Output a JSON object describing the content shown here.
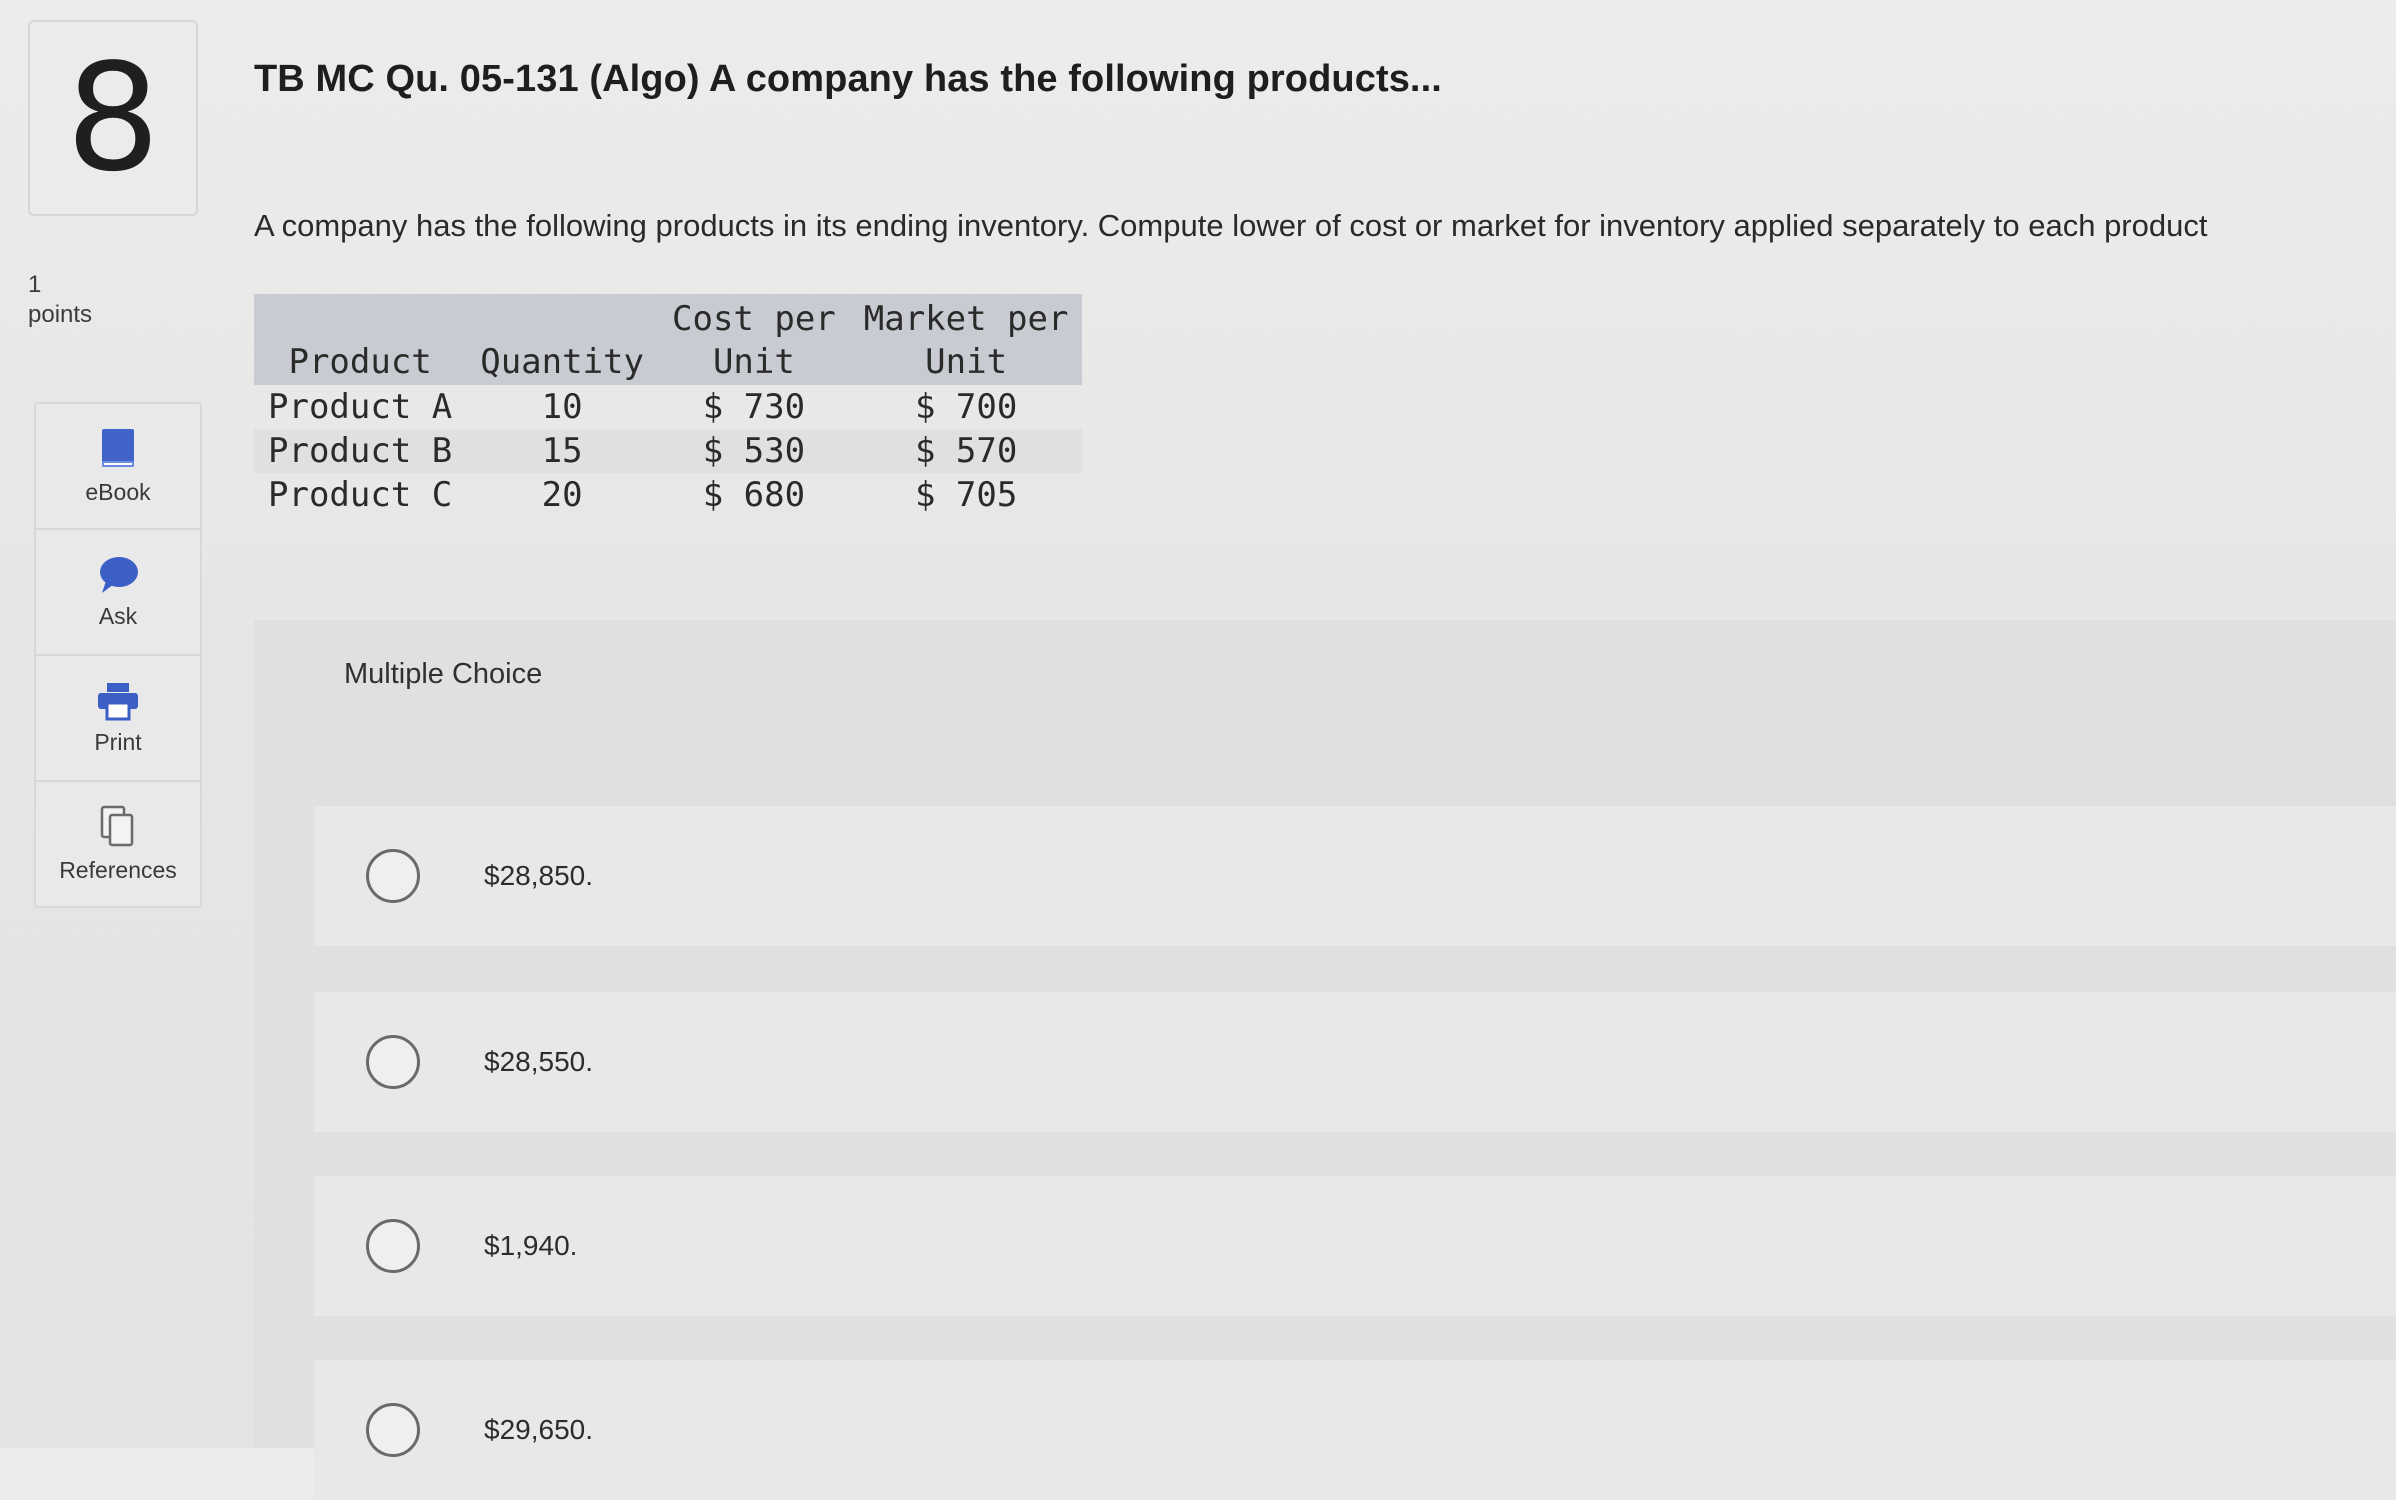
{
  "question": {
    "number": "8",
    "points_value": "1",
    "points_label": "points",
    "title": "TB MC Qu. 05-131 (Algo) A company has the following products...",
    "prompt": "A company has the following products in its ending inventory. Compute lower of cost or market for inventory applied separately to each product"
  },
  "tools": [
    {
      "label": "eBook",
      "icon": "book-icon",
      "color": "#3f63c9"
    },
    {
      "label": "Ask",
      "icon": "speech-bubble-icon",
      "color": "#3b5fc4"
    },
    {
      "label": "Print",
      "icon": "printer-icon",
      "color": "#3b5fc4"
    },
    {
      "label": "References",
      "icon": "pages-icon",
      "color": "#6a6a6a"
    }
  ],
  "table": {
    "headers": [
      {
        "line1": "",
        "line2": "Product"
      },
      {
        "line1": "",
        "line2": "Quantity"
      },
      {
        "line1": "Cost per",
        "line2": "Unit"
      },
      {
        "line1": "Market per",
        "line2": "Unit"
      }
    ],
    "rows": [
      {
        "product": "Product A",
        "quantity": "10",
        "cost": "$ 730",
        "market": "$ 700"
      },
      {
        "product": "Product B",
        "quantity": "15",
        "cost": "$ 530",
        "market": "$ 570"
      },
      {
        "product": "Product C",
        "quantity": "20",
        "cost": "$ 680",
        "market": "$ 705"
      }
    ]
  },
  "multiple_choice": {
    "header": "Multiple Choice",
    "options": [
      "$28,850.",
      "$28,550.",
      "$1,940.",
      "$29,650."
    ]
  }
}
